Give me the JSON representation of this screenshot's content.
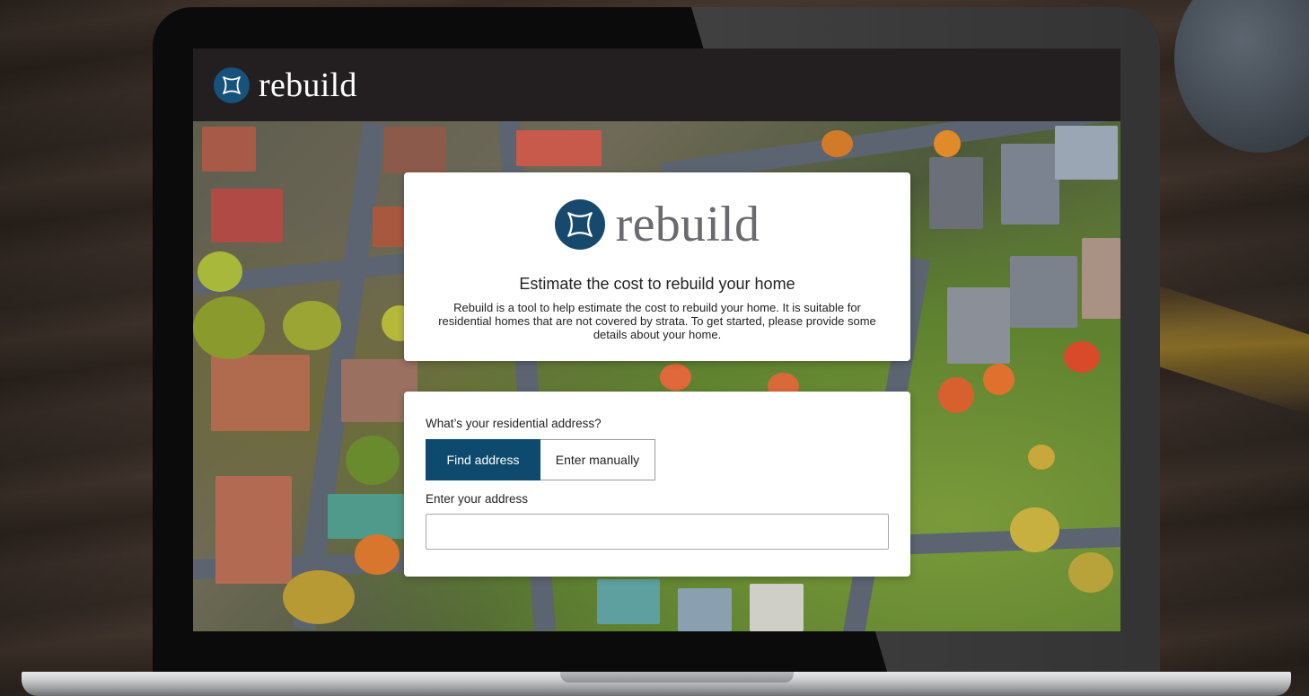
{
  "brand": {
    "name": "rebuild",
    "colors": {
      "primary": "#0d4a6e",
      "header_bg": "#231f20",
      "logo_mark": "#17527a"
    }
  },
  "intro": {
    "title": "Estimate the cost to rebuild your home",
    "description": "Rebuild is a tool to help estimate the cost to rebuild your home. It is suitable for residential homes that are not covered by strata. To get started, please provide some details about your home."
  },
  "address_form": {
    "question": "What’s your residential address?",
    "options": [
      {
        "label": "Find address",
        "selected": true
      },
      {
        "label": "Enter manually",
        "selected": false
      }
    ],
    "input_label": "Enter your address",
    "input_value": "",
    "input_placeholder": ""
  },
  "icons": {
    "logo": "sparkle-star-icon"
  }
}
